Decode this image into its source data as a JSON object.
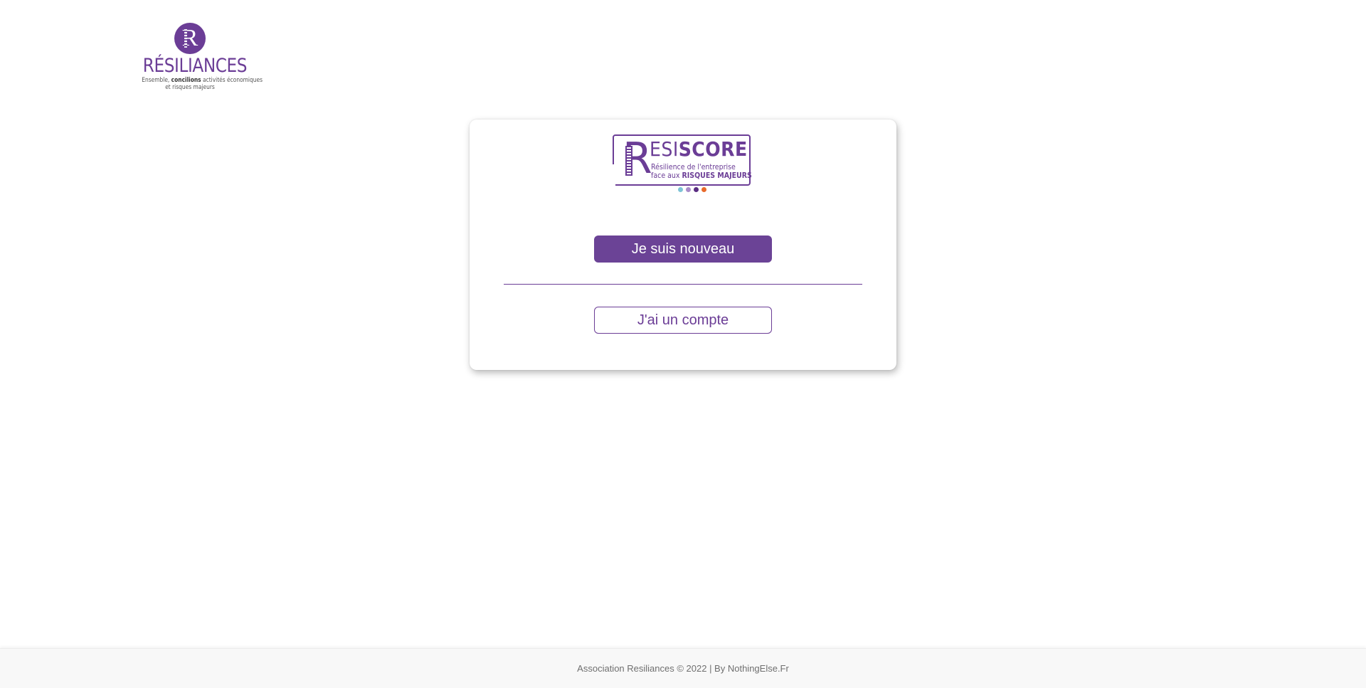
{
  "brand": {
    "logo_letter": "R",
    "wordmark": "RÉSILIANCES",
    "tagline_part1": "Ensemble, ",
    "tagline_bold": "concilions",
    "tagline_part2": " activités économiques",
    "tagline_line2": "et risques majeurs"
  },
  "resiscore_logo": {
    "letter": "R",
    "title_light": "ESI",
    "title_bold": "SCORE",
    "subtitle_line1": "Résilience de l'entreprise",
    "subtitle_line2_prefix": "face aux ",
    "subtitle_line2_bold": "RISQUES MAJEURS",
    "dot_colors": [
      "#7ec4d6",
      "#a98cc9",
      "#5a2d82",
      "#e86a2b"
    ]
  },
  "card": {
    "new_user_label": "Je suis nouveau",
    "have_account_label": "J'ai un compte"
  },
  "footer": {
    "text": "Association Resiliances © 2022 | By NothingElse.Fr"
  },
  "colors": {
    "brand_purple": "#6b3d96",
    "button_purple": "#6b4396"
  }
}
